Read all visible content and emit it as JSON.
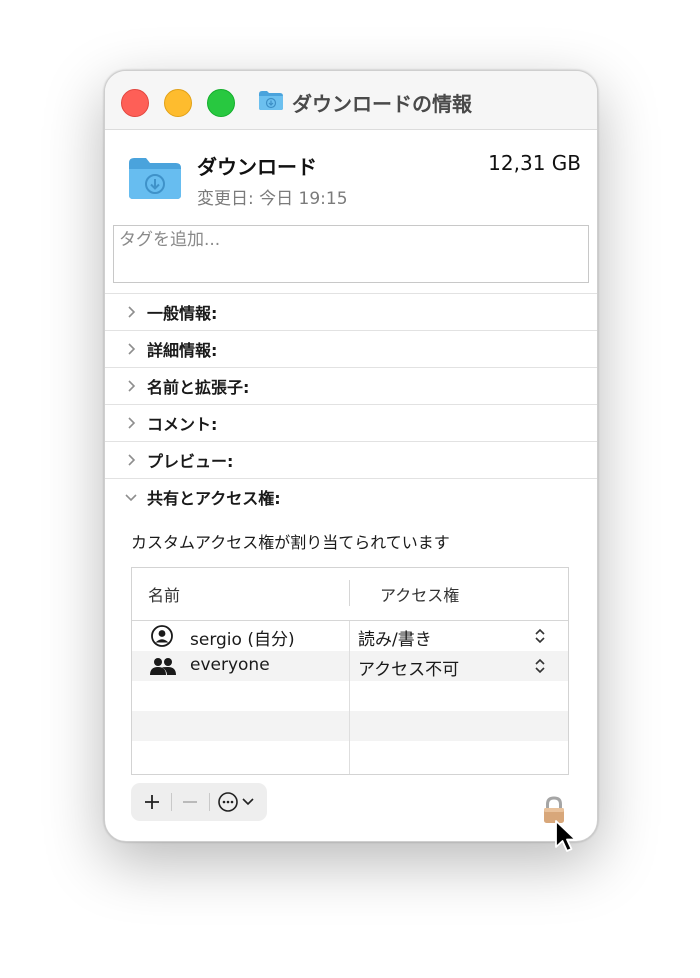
{
  "window": {
    "title": "ダウンロードの情報"
  },
  "header": {
    "name": "ダウンロード",
    "size": "12,31 GB",
    "modified": "変更日: 今日 19:15"
  },
  "tags": {
    "placeholder": "タグを追加..."
  },
  "sections": [
    {
      "label": "一般情報:",
      "expanded": false
    },
    {
      "label": "詳細情報:",
      "expanded": false
    },
    {
      "label": "名前と拡張子:",
      "expanded": false
    },
    {
      "label": "コメント:",
      "expanded": false
    },
    {
      "label": "プレビュー:",
      "expanded": false
    },
    {
      "label": "共有とアクセス権:",
      "expanded": true
    }
  ],
  "sharing": {
    "note": "カスタムアクセス権が割り当てられています",
    "columns": {
      "name": "名前",
      "access": "アクセス権"
    },
    "rows": [
      {
        "name": "sergio (自分)",
        "access": "読み/書き",
        "icon": "user-icon"
      },
      {
        "name": "everyone",
        "access": "アクセス不可",
        "icon": "group-icon"
      }
    ]
  },
  "colors": {
    "close": "#fe5f57",
    "minimize": "#febc2e",
    "zoom": "#28c840",
    "folder": "#5fb5e8"
  }
}
